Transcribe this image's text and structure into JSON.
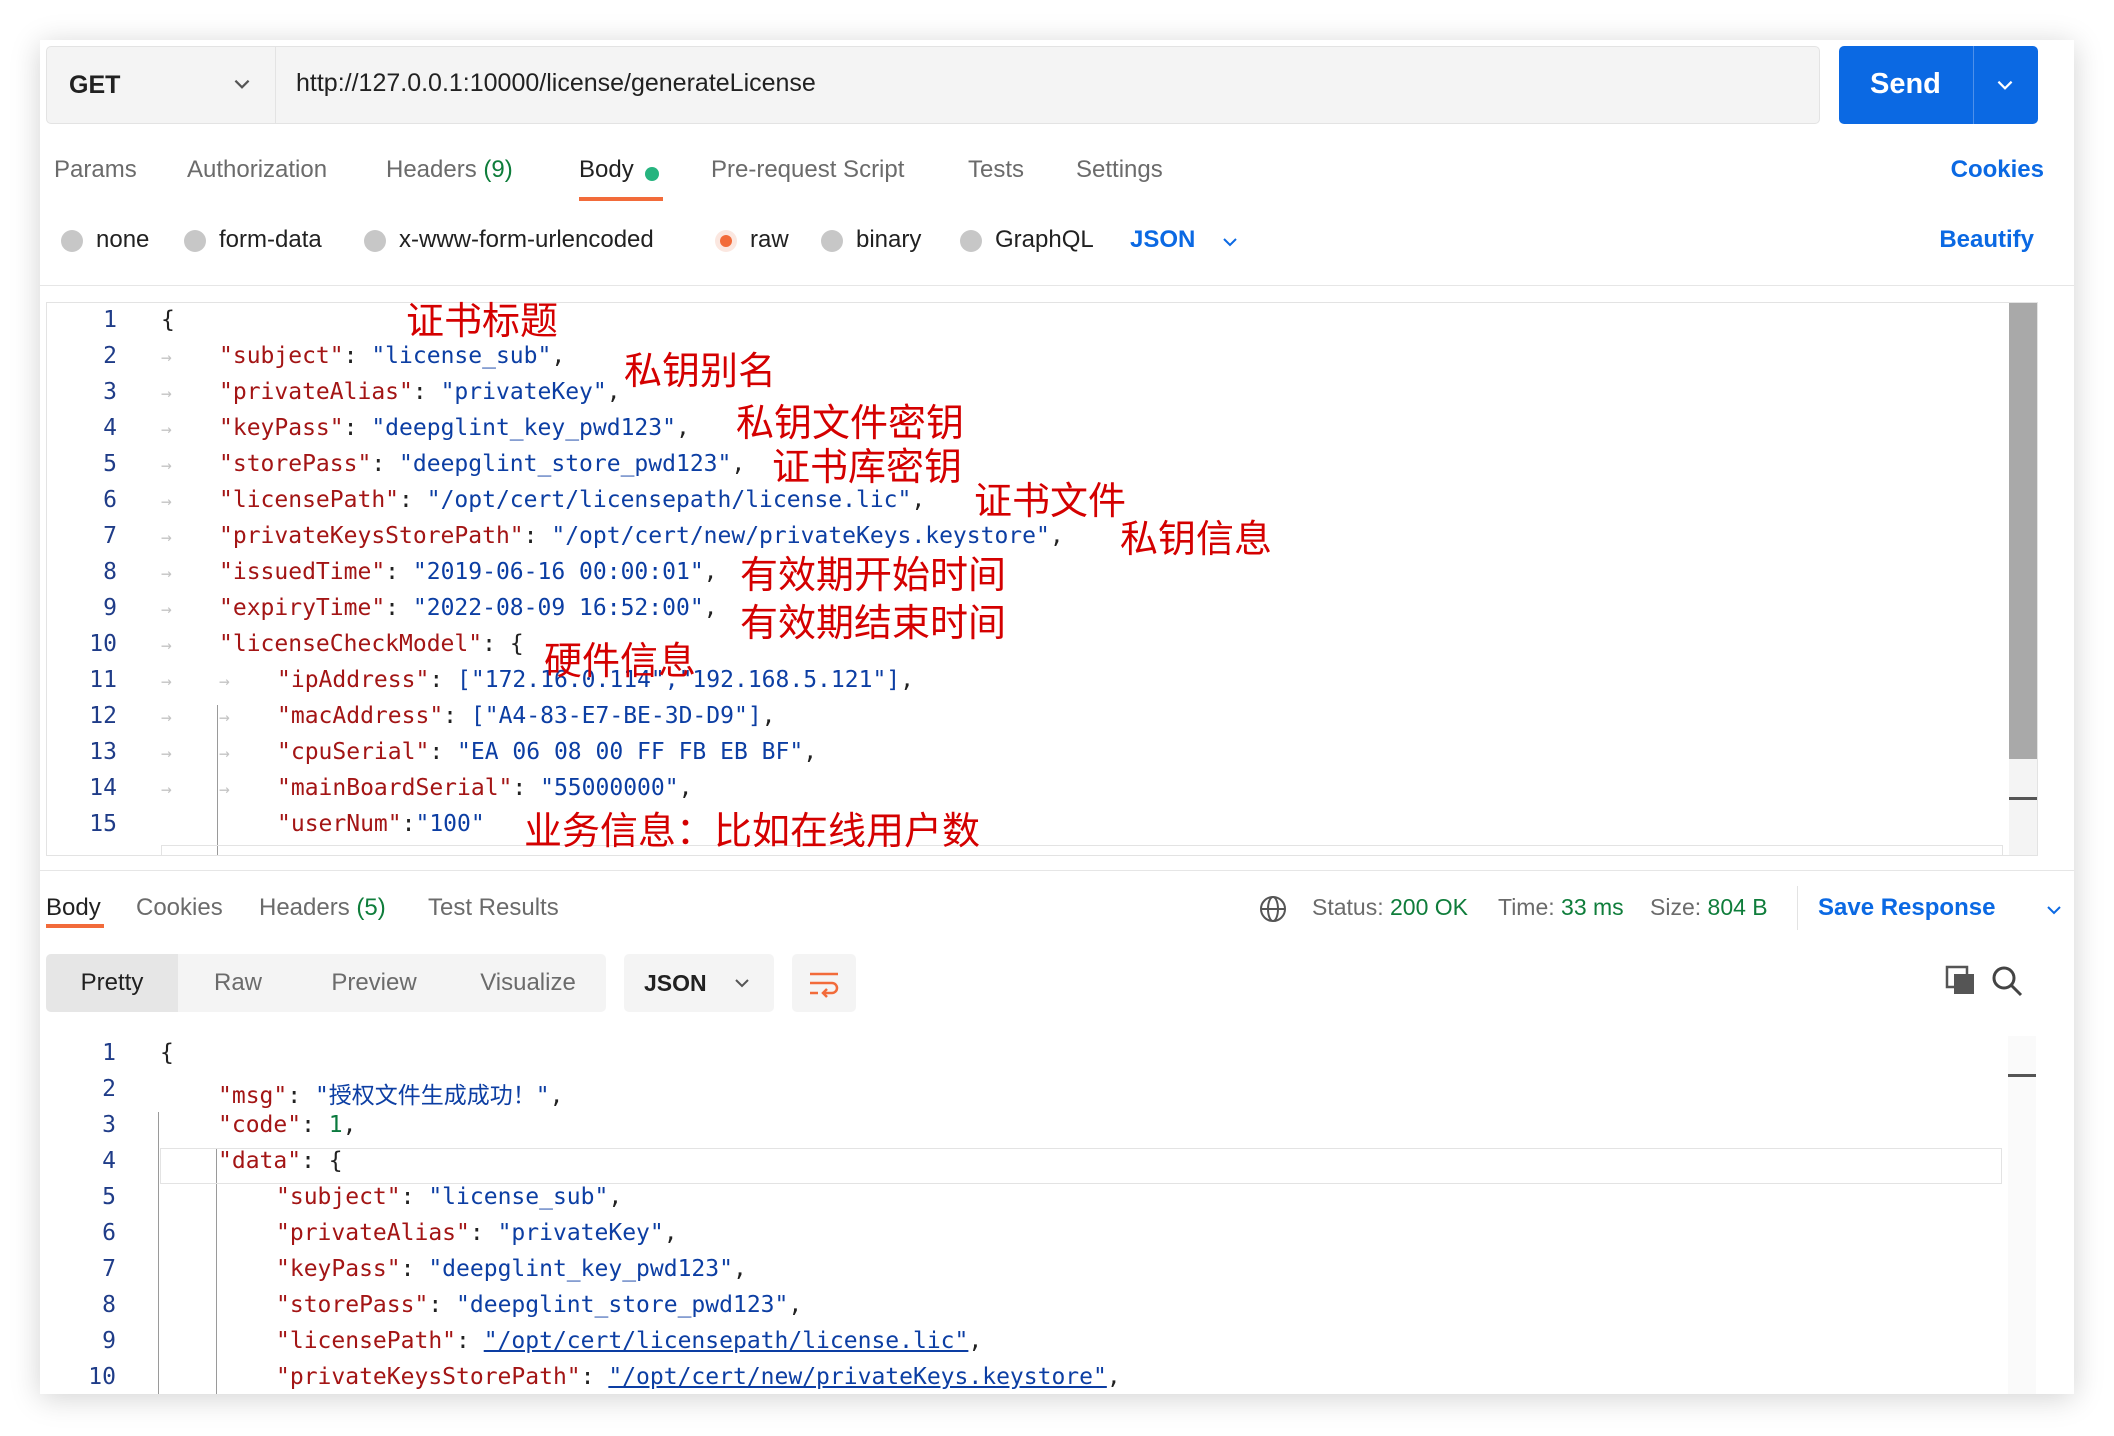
{
  "request": {
    "method": "GET",
    "url": "http://127.0.0.1:10000/license/generateLicense",
    "send_label": "Send",
    "tabs": [
      {
        "label": "Params"
      },
      {
        "label": "Authorization"
      },
      {
        "label": "Headers",
        "count": "(9)"
      },
      {
        "label": "Body"
      },
      {
        "label": "Pre-request Script"
      },
      {
        "label": "Tests"
      },
      {
        "label": "Settings"
      }
    ],
    "cookies_label": "Cookies",
    "body_types": [
      "none",
      "form-data",
      "x-www-form-urlencoded",
      "raw",
      "binary",
      "GraphQL"
    ],
    "selected_body_type": "raw",
    "format": "JSON",
    "beautify_label": "Beautify",
    "lines": [
      {
        "n": "1",
        "open": "{"
      },
      {
        "n": "2",
        "key": "\"subject\"",
        "val": "\"license_sub\""
      },
      {
        "n": "3",
        "key": "\"privateAlias\"",
        "val": "\"privateKey\""
      },
      {
        "n": "4",
        "key": "\"keyPass\"",
        "val": "\"deepglint_key_pwd123\""
      },
      {
        "n": "5",
        "key": "\"storePass\"",
        "val": "\"deepglint_store_pwd123\""
      },
      {
        "n": "6",
        "key": "\"licensePath\"",
        "val": "\"/opt/cert/licensepath/license.lic\""
      },
      {
        "n": "7",
        "key": "\"privateKeysStorePath\"",
        "val": "\"/opt/cert/new/privateKeys.keystore\""
      },
      {
        "n": "8",
        "key": "\"issuedTime\"",
        "val": "\"2019-06-16 00:00:01\""
      },
      {
        "n": "9",
        "key": "\"expiryTime\"",
        "val": "\"2022-08-09 16:52:00\""
      },
      {
        "n": "10",
        "key": "\"licenseCheckModel\"",
        "val": "{"
      },
      {
        "n": "11",
        "key": "\"ipAddress\"",
        "val": "[\"172.16.0.114\",\"192.168.5.121\"]"
      },
      {
        "n": "12",
        "key": "\"macAddress\"",
        "val": "[\"A4-83-E7-BE-3D-D9\"]"
      },
      {
        "n": "13",
        "key": "\"cpuSerial\"",
        "val": "\"EA 06 08 00 FF FB EB BF\""
      },
      {
        "n": "14",
        "key": "\"mainBoardSerial\"",
        "val": "\"55000000\""
      },
      {
        "n": "15",
        "key": "\"userNum\"",
        "val": "\"100\""
      }
    ],
    "annotations": [
      "证书标题",
      "私钥别名",
      "私钥文件密钥",
      "证书库密钥",
      "证书文件",
      "私钥信息",
      "有效期开始时间",
      "有效期结束时间",
      "硬件信息",
      "业务信息：比如在线用户数"
    ]
  },
  "response": {
    "tabs": [
      {
        "label": "Body"
      },
      {
        "label": "Cookies"
      },
      {
        "label": "Headers",
        "count": "(5)"
      },
      {
        "label": "Test Results"
      }
    ],
    "status_label": "Status:",
    "status_value": "200 OK",
    "time_label": "Time:",
    "time_value": "33 ms",
    "size_label": "Size:",
    "size_value": "804 B",
    "save_label": "Save Response",
    "views": [
      "Pretty",
      "Raw",
      "Preview",
      "Visualize"
    ],
    "format": "JSON",
    "lines": [
      {
        "n": "1",
        "open": "{"
      },
      {
        "n": "2",
        "key": "\"msg\"",
        "val": "\"授权文件生成成功！\""
      },
      {
        "n": "3",
        "key": "\"code\"",
        "val": "1"
      },
      {
        "n": "4",
        "key": "\"data\"",
        "val": "{"
      },
      {
        "n": "5",
        "key": "\"subject\"",
        "val": "\"license_sub\""
      },
      {
        "n": "6",
        "key": "\"privateAlias\"",
        "val": "\"privateKey\""
      },
      {
        "n": "7",
        "key": "\"keyPass\"",
        "val": "\"deepglint_key_pwd123\""
      },
      {
        "n": "8",
        "key": "\"storePass\"",
        "val": "\"deepglint_store_pwd123\""
      },
      {
        "n": "9",
        "key": "\"licensePath\"",
        "val": "\"/opt/cert/licensepath/license.lic\""
      },
      {
        "n": "10",
        "key": "\"privateKeysStorePath\"",
        "val": "\"/opt/cert/new/privateKeys.keystore\""
      }
    ]
  },
  "colors": {
    "accent": "#0b69e3",
    "tab_underline": "#f26b3a",
    "annotation": "#d40000",
    "success": "#0f7d3b"
  }
}
